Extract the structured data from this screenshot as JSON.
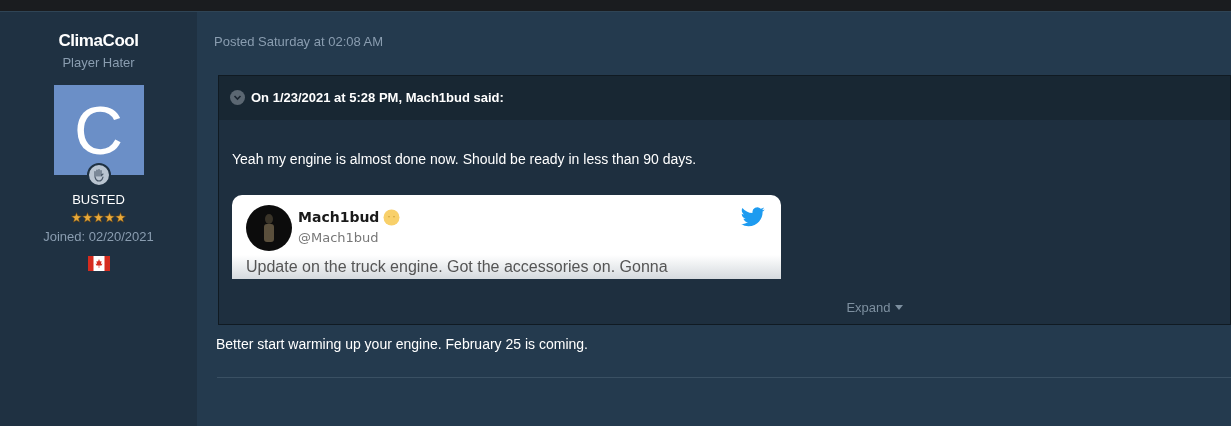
{
  "author": {
    "name": "ClimaCool",
    "title": "Player Hater",
    "avatar_letter": "C",
    "group": "BUSTED",
    "stars": 5,
    "joined": "Joined: 02/20/2021"
  },
  "post": {
    "date": "Posted Saturday at 02:08 AM",
    "quote": {
      "header": "On 1/23/2021 at 5:28 PM, Mach1bud said:",
      "text": "Yeah my engine is almost done now. Should be ready in less than 90 days.",
      "tweet": {
        "name": "Mach1bud",
        "handle": "@Mach1bud",
        "text": "Update on the truck engine. Got the accessories on. Gonna"
      },
      "expand": "Expand"
    },
    "body": "Better start warming up your engine. February 25 is coming."
  }
}
